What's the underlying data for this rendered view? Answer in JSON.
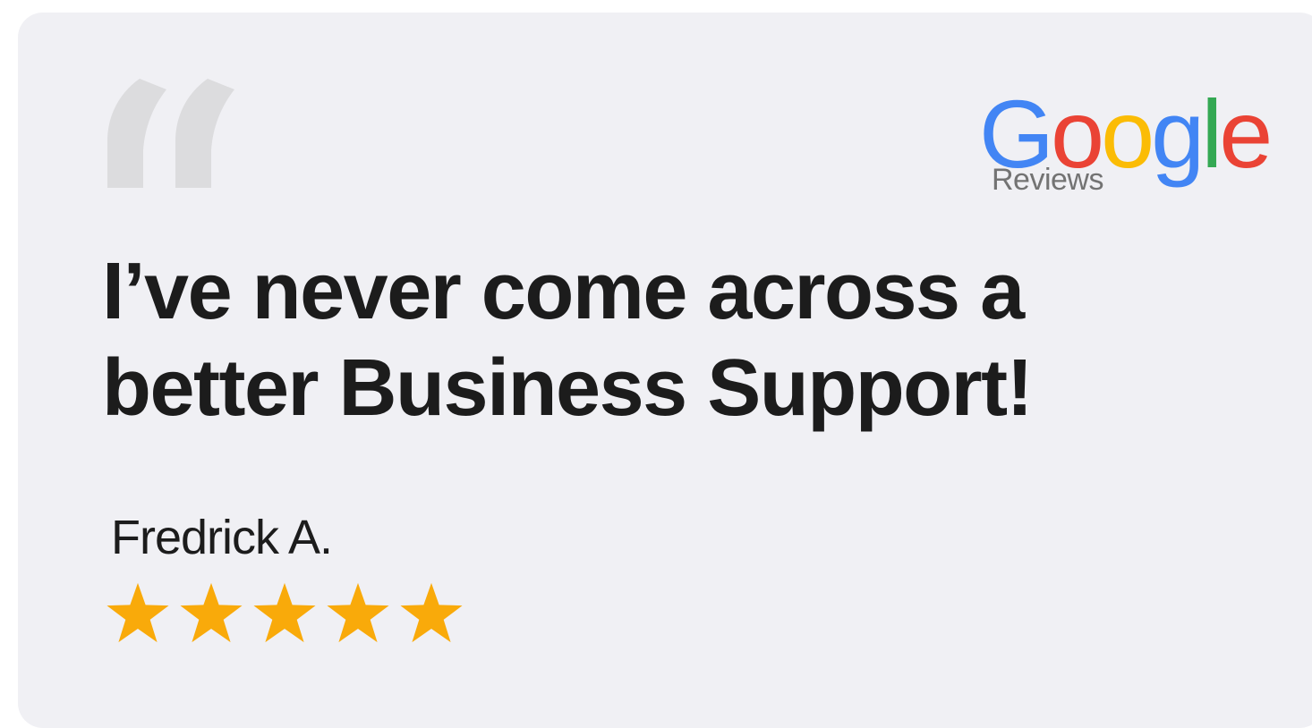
{
  "brand": {
    "word_letters": [
      "G",
      "o",
      "o",
      "g",
      "l",
      "e"
    ],
    "letter_colors": [
      "#4285F4",
      "#EA4335",
      "#FBBC05",
      "#4285F4",
      "#34A853",
      "#EA4335"
    ],
    "sub_label": "Reviews"
  },
  "review": {
    "line1": "I’ve never come across a",
    "line2": "better Business Support!",
    "reviewer": "Fredrick A.",
    "rating": 5,
    "rating_max": 5
  },
  "colors": {
    "card_background": "#f0f0f4",
    "quote_mark": "#dcdcde",
    "star": "#f9aa0a",
    "text": "#1c1c1c"
  },
  "icons": {
    "quote": "quote-icon",
    "star": "star-icon"
  }
}
